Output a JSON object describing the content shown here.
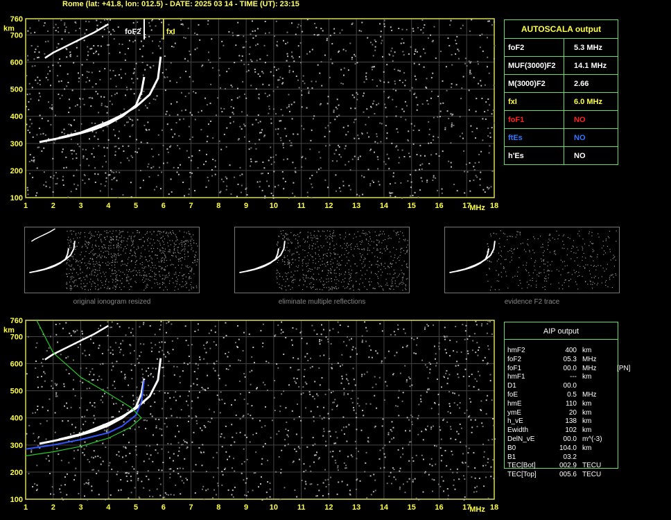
{
  "header": "Rome (lat: +41.8, lon: 012.5) - DATE: 2025 03 14 - TIME (UT): 23:15",
  "chart_data": [
    {
      "type": "scatter",
      "xlabel": "MHz",
      "ylabel": "km",
      "xlim": [
        1,
        18
      ],
      "ylim": [
        100,
        760
      ],
      "xticks": [
        "1",
        "2",
        "3",
        "4",
        "5",
        "6",
        "7",
        "8",
        "9",
        "10",
        "11",
        "12",
        "13",
        "14",
        "15",
        "16",
        "17",
        "18"
      ],
      "yticks": [
        "100",
        "200",
        "300",
        "400",
        "500",
        "600",
        "700",
        "760"
      ],
      "annotations": [
        "foF2",
        "fxI"
      ],
      "traces": {
        "o_trace": [
          [
            1.5,
            305
          ],
          [
            2,
            315
          ],
          [
            2.5,
            325
          ],
          [
            3,
            338
          ],
          [
            3.5,
            352
          ],
          [
            4,
            372
          ],
          [
            4.5,
            400
          ],
          [
            5,
            440
          ],
          [
            5.2,
            490
          ],
          [
            5.3,
            545
          ]
        ],
        "x_trace": [
          [
            2.2,
            320
          ],
          [
            3,
            340
          ],
          [
            3.5,
            360
          ],
          [
            4,
            380
          ],
          [
            4.5,
            405
          ],
          [
            5,
            435
          ],
          [
            5.5,
            480
          ],
          [
            5.8,
            540
          ],
          [
            5.9,
            620
          ]
        ],
        "multiple": [
          [
            1.7,
            615
          ],
          [
            2,
            635
          ],
          [
            2.5,
            660
          ],
          [
            3,
            685
          ],
          [
            3.5,
            710
          ],
          [
            4,
            740
          ]
        ]
      },
      "marker_lines": {
        "foF2": 5.3,
        "fxI": 6.0
      }
    },
    {
      "type": "scatter",
      "xlabel": "MHz",
      "ylabel": "km",
      "xlim": [
        1,
        18
      ],
      "ylim": [
        100,
        760
      ],
      "xticks": [
        "1",
        "2",
        "3",
        "4",
        "5",
        "6",
        "7",
        "8",
        "9",
        "10",
        "11",
        "12",
        "13",
        "14",
        "15",
        "16",
        "17",
        "18"
      ],
      "yticks": [
        "100",
        "200",
        "300",
        "400",
        "500",
        "600",
        "700",
        "760"
      ],
      "profile_blue": [
        [
          1,
          285
        ],
        [
          2,
          300
        ],
        [
          3,
          320
        ],
        [
          4,
          345
        ],
        [
          4.5,
          370
        ],
        [
          5,
          410
        ],
        [
          5.2,
          460
        ],
        [
          5.3,
          540
        ]
      ],
      "profile_green": [
        [
          1,
          260
        ],
        [
          2,
          275
        ],
        [
          3,
          295
        ],
        [
          4,
          325
        ],
        [
          4.8,
          365
        ],
        [
          5.2,
          400
        ],
        [
          4.8,
          440
        ],
        [
          4,
          490
        ],
        [
          3,
          550
        ],
        [
          2,
          640
        ],
        [
          1.4,
          760
        ]
      ]
    }
  ],
  "autoscala": {
    "title": "AUTOSCALA output",
    "rows": [
      {
        "key": "foF2",
        "value": "5.3 MHz",
        "color": "#ffffff"
      },
      {
        "key": "MUF(3000)F2",
        "value": "14.1 MHz",
        "color": "#ffffff"
      },
      {
        "key": "M(3000)F2",
        "value": "2.66",
        "color": "#ffffff"
      },
      {
        "key": "fxI",
        "value": "6.0 MHz",
        "color": "#ffff44"
      },
      {
        "key": "foF1",
        "value": "NO",
        "color": "#ff2222"
      },
      {
        "key": "ftEs",
        "value": "NO",
        "color": "#3377ff"
      },
      {
        "key": "h'Es",
        "value": "NO",
        "color": "#ffffff"
      }
    ]
  },
  "thumbs": [
    {
      "title": "original ionogram resized"
    },
    {
      "title": "eliminate multiple reflections"
    },
    {
      "title": "evidence F2 trace"
    }
  ],
  "aip": {
    "title": "AIP output",
    "rows": [
      [
        "hmF2",
        "400",
        "km",
        ""
      ],
      [
        "foF2",
        "05.3",
        "MHz",
        ""
      ],
      [
        "foF1",
        "00.0",
        "MHz",
        "[PN]"
      ],
      [
        "hmF1",
        "---",
        "km",
        ""
      ],
      [
        "D1",
        "00.0",
        "",
        ""
      ],
      [
        "foE",
        "0.5",
        "MHz",
        ""
      ],
      [
        "hmE",
        "110",
        "km",
        ""
      ],
      [
        "ymE",
        "20",
        "km",
        ""
      ],
      [
        "h_vE",
        "138",
        "km",
        ""
      ],
      [
        "Ewidth",
        "102",
        "km",
        ""
      ],
      [
        "DelN_vE",
        "00.0",
        "m^(-3)",
        ""
      ],
      [
        "B0",
        "104.0",
        "km",
        ""
      ],
      [
        "B1",
        "03.2",
        "",
        ""
      ],
      [
        "TEC[Bot]",
        "002.9",
        "TECU",
        ""
      ],
      [
        "TEC[Top]",
        "005.6",
        "TECU",
        ""
      ]
    ]
  }
}
